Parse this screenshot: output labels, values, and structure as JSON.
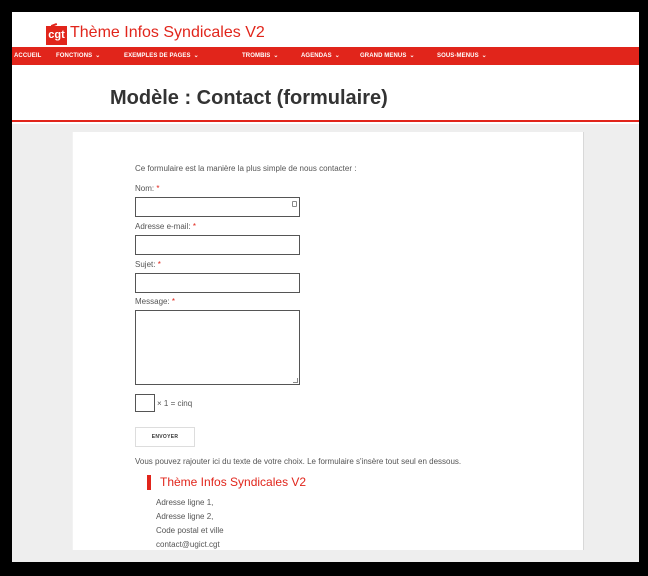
{
  "header": {
    "logo_text": "cgt",
    "site_title": "Thème Infos Syndicales V2"
  },
  "nav": {
    "items": [
      {
        "label": "ACCUEIL",
        "has_children": false
      },
      {
        "label": "FONCTIONS",
        "has_children": true
      },
      {
        "label": "EXEMPLES DE PAGES",
        "has_children": true
      },
      {
        "label": "TROMBIS",
        "has_children": true
      },
      {
        "label": "AGENDAS",
        "has_children": true
      },
      {
        "label": "GRAND MENUS",
        "has_children": true
      },
      {
        "label": "SOUS-MENUS",
        "has_children": true
      }
    ],
    "chevron": "⌄"
  },
  "page": {
    "title": "Modèle : Contact (formulaire)"
  },
  "form": {
    "intro": "Ce formulaire est la manière la plus simple de nous contacter :",
    "required_mark": "*",
    "name_label": "Nom:",
    "name_value": "",
    "email_label": "Adresse e-mail:",
    "email_value": "",
    "subject_label": "Sujet:",
    "subject_value": "",
    "message_label": "Message:",
    "message_value": "",
    "captcha_value": "",
    "captcha_text": "× 1 = cinq",
    "submit_label": "ENVOYER",
    "after_text": "Vous pouvez rajouter ici du texte de votre choix. Le formulaire s'insère tout seul en dessous."
  },
  "address": {
    "title": "Thème Infos Syndicales V2",
    "lines": [
      "Adresse ligne 1,",
      "Adresse ligne 2,",
      "Code postal et ville",
      "contact@ugict.cgt"
    ]
  },
  "colors": {
    "accent": "#e1251b",
    "text": "#555555",
    "background": "#eeeeee"
  }
}
